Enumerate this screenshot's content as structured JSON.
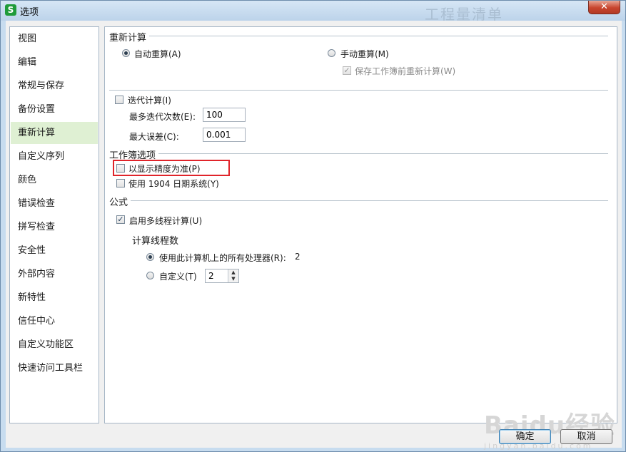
{
  "window": {
    "title": "选项",
    "app_icon": "S",
    "background_text": "工程量清单",
    "close_glyph": "✕"
  },
  "sidebar": {
    "items": [
      {
        "label": "视图"
      },
      {
        "label": "编辑"
      },
      {
        "label": "常规与保存"
      },
      {
        "label": "备份设置"
      },
      {
        "label": "重新计算",
        "selected": true
      },
      {
        "label": "自定义序列"
      },
      {
        "label": "颜色"
      },
      {
        "label": "错误检查"
      },
      {
        "label": "拼写检查"
      },
      {
        "label": "安全性"
      },
      {
        "label": "外部内容"
      },
      {
        "label": "新特性"
      },
      {
        "label": "信任中心"
      },
      {
        "label": "自定义功能区"
      },
      {
        "label": "快速访问工具栏"
      }
    ]
  },
  "recalc": {
    "title": "重新计算",
    "auto": {
      "label": "自动重算(A)",
      "checked": true
    },
    "manual": {
      "label": "手动重算(M)",
      "checked": false
    },
    "save_before": {
      "label": "保存工作簿前重新计算(W)",
      "checked": true,
      "disabled": true
    }
  },
  "iteration": {
    "checkbox": {
      "label": "迭代计算(I)",
      "checked": false
    },
    "max_iter": {
      "label": "最多迭代次数(E):",
      "value": "100"
    },
    "max_change": {
      "label": "最大误差(C):",
      "value": "0.001"
    }
  },
  "workbook": {
    "title": "工作簿选项",
    "precision": {
      "label": "以显示精度为准(P)",
      "checked": false
    },
    "date1904": {
      "label": "使用 1904 日期系统(Y)",
      "checked": false
    }
  },
  "formula": {
    "title": "公式",
    "multithread": {
      "label": "启用多线程计算(U)",
      "checked": true
    },
    "threads_title": "计算线程数",
    "all_processors": {
      "label": "使用此计算机上的所有处理器(R):",
      "count": "2",
      "checked": true
    },
    "custom": {
      "label": "自定义(T)",
      "value": "2",
      "checked": false
    }
  },
  "buttons": {
    "ok": "确定",
    "cancel": "取消"
  },
  "watermark": {
    "logo": "Baidu经验",
    "url": "jingyan.baidu.com"
  },
  "colors": {
    "selected_nav": "#dff0d3",
    "highlight_border": "#e0242a"
  }
}
